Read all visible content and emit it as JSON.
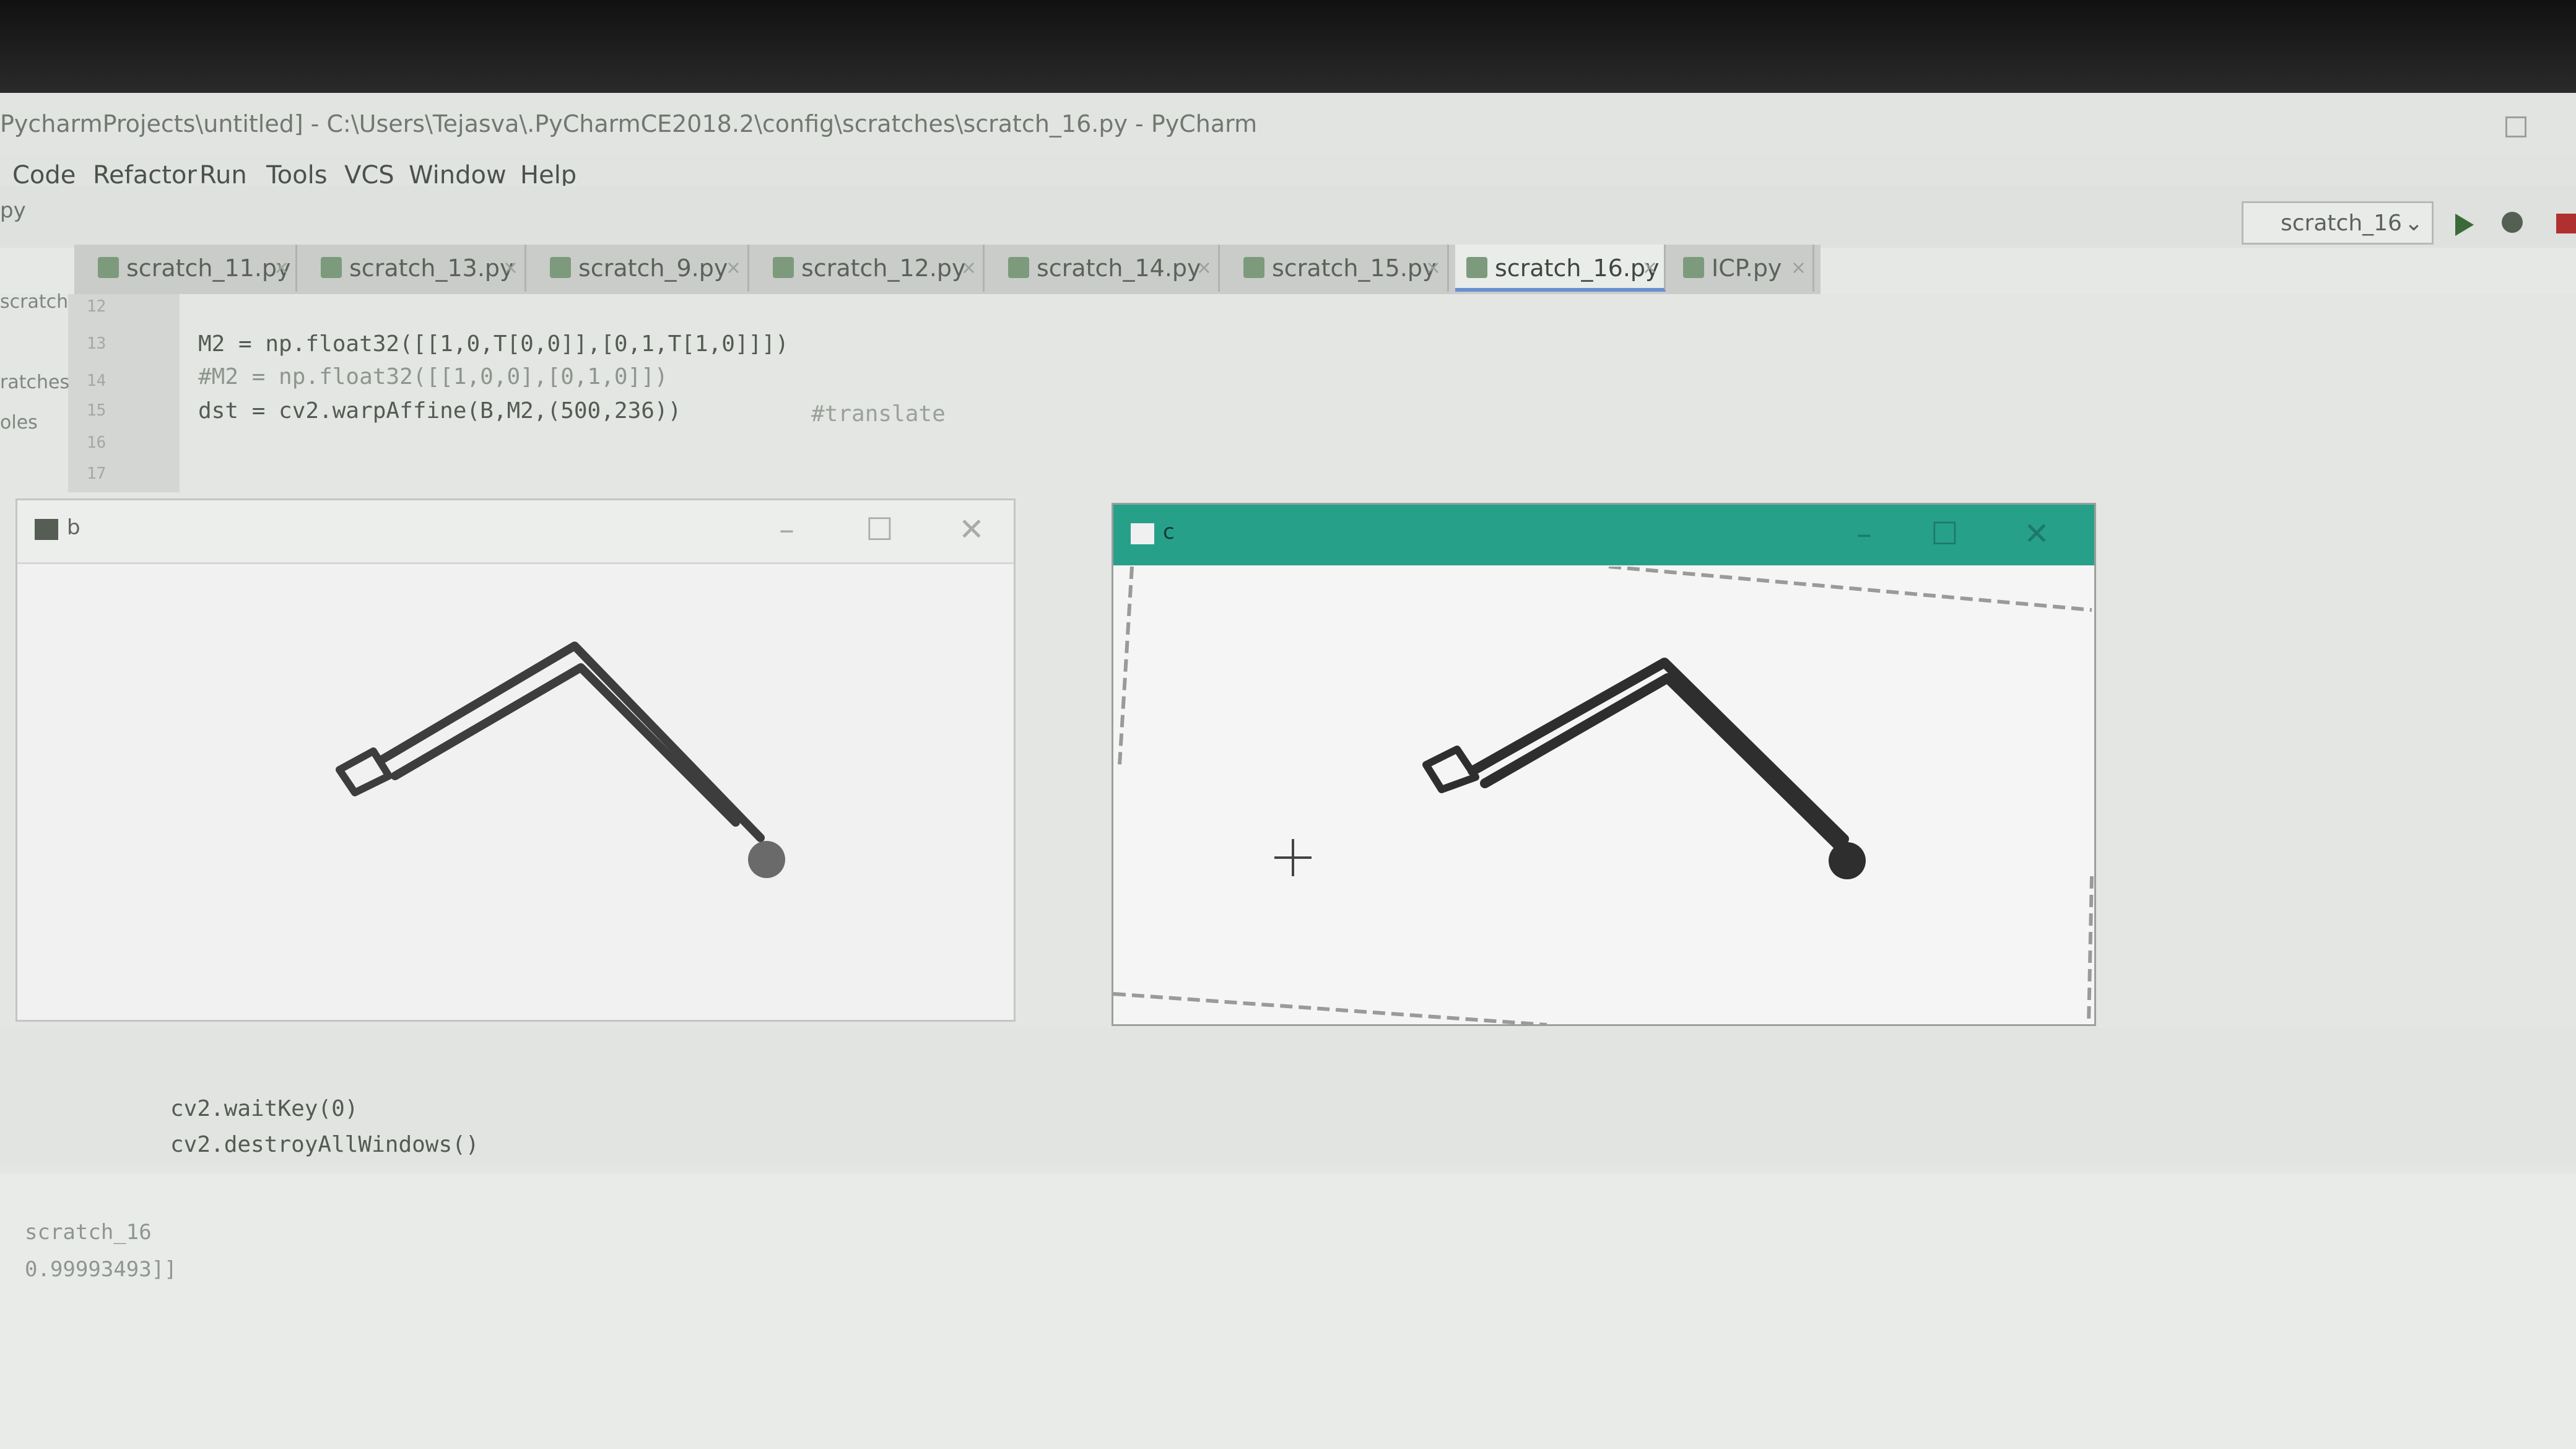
{
  "ide": {
    "title": "PycharmProjects\\untitled] - C:\\Users\\Tejasva\\.PyCharmCE2018.2\\config\\scratches\\scratch_16.py - PyCharm",
    "menu": [
      "Code",
      "Refactor",
      "Run",
      "Tools",
      "VCS",
      "Window",
      "Help"
    ],
    "breadcrumb": "py",
    "run_config": "scratch_16",
    "run_config_chevron": "⌄"
  },
  "tabs": [
    {
      "label": "scratch_11.py",
      "close": "×"
    },
    {
      "label": "scratch_13.py",
      "close": "×"
    },
    {
      "label": "scratch_9.py",
      "close": "×"
    },
    {
      "label": "scratch_12.py",
      "close": "×"
    },
    {
      "label": "scratch_14.py",
      "close": "×"
    },
    {
      "label": "scratch_15.py",
      "close": "×"
    },
    {
      "label": "scratch_16.py",
      "close": "×",
      "active": true
    },
    {
      "label": "ICP.py",
      "close": "×"
    }
  ],
  "editor": {
    "line_numbers": [
      "12",
      "13",
      "14",
      "15",
      "16",
      "17"
    ],
    "line1": "M2 = np.float32([[1,0,T[0,0]],[0,1,T[1,0]]])",
    "line2": "#M2 = np.float32([[1,0,0],[0,1,0]])",
    "line3": "dst = cv2.warpAffine(B,M2,(500,236))",
    "line3_comment": "#translate",
    "lower1": "cv2.waitKey(0)",
    "lower2": "cv2.destroyAllWindows()",
    "left_fragments": [
      "scratch",
      "ratches",
      "oles"
    ]
  },
  "windows": {
    "a": {
      "title": "b",
      "minimize": "–",
      "maximize": "☐",
      "close": "✕"
    },
    "b": {
      "title": "c",
      "minimize": "–",
      "maximize": "☐",
      "close": "✕",
      "titlebar_color": "#27a08a"
    }
  },
  "console": {
    "run_label": "scratch_16",
    "output": "0.99993493]]"
  }
}
